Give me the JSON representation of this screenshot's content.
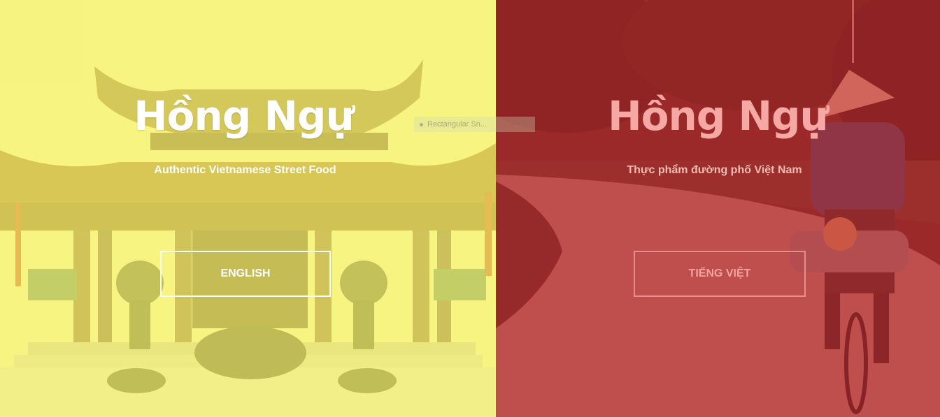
{
  "left": {
    "title": "Hồng Ngự",
    "subtitle": "Authentic Vietnamese Street Food",
    "button_label": "ENGLISH",
    "overlay_color": "#faf86e",
    "image": "temple-photo"
  },
  "right": {
    "title": "Hồng Ngự",
    "subtitle": "Thực phẩm đường phố Việt Nam",
    "button_label": "TIẾNG VIỆT",
    "overlay_color": "#cd282d",
    "image": "cyclist-photo"
  },
  "tooltip": {
    "label": "Rectangular Sn..."
  }
}
